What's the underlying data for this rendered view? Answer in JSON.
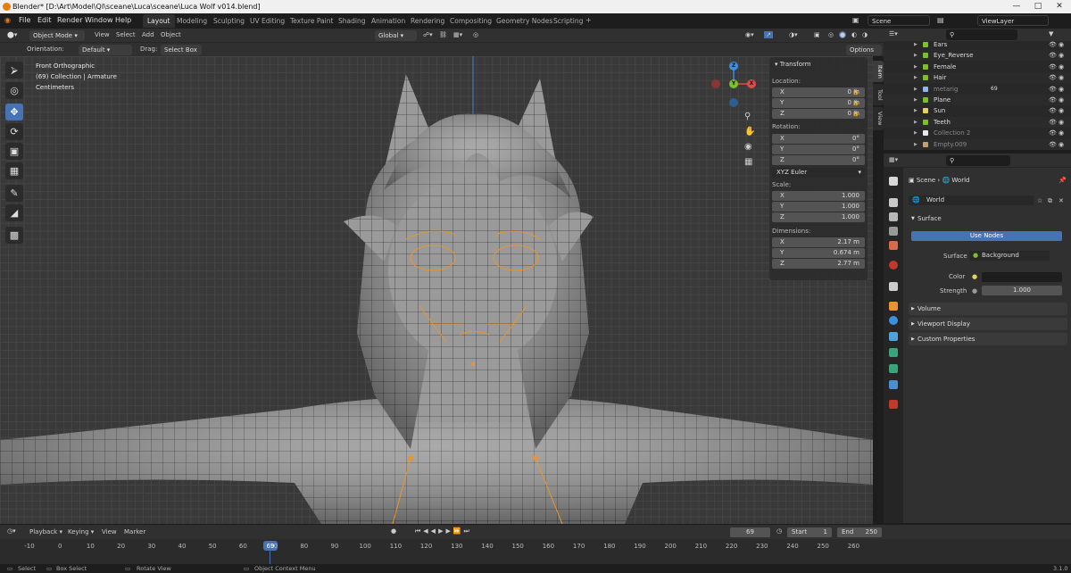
{
  "window": {
    "title": "Blender* [D:\\Art\\Model\\QI\\sceane\\Luca\\sceane\\Luca Wolf v014.blend]"
  },
  "menu": [
    "File",
    "Edit",
    "Render",
    "Window",
    "Help"
  ],
  "workspaces": [
    "Layout",
    "Modeling",
    "Sculpting",
    "UV Editing",
    "Texture Paint",
    "Shading",
    "Animation",
    "Rendering",
    "Compositing",
    "Geometry Nodes",
    "Scripting"
  ],
  "active_workspace": "Layout",
  "scene": "Scene",
  "view_layer": "ViewLayer",
  "viewport_header": {
    "mode": "Object Mode",
    "menus": [
      "View",
      "Select",
      "Add",
      "Object"
    ],
    "transform_orientation": "Global"
  },
  "tool_options": {
    "orientation_label": "Orientation:",
    "orientation_value": "Default",
    "drag_label": "Drag:",
    "drag_value": "Select Box",
    "options": "Options"
  },
  "viewport_info": {
    "view": "Front Orthographic",
    "collection": "(69) Collection | Armature",
    "units": "Centimeters"
  },
  "npanel": {
    "tabs": [
      "Item",
      "Tool",
      "View"
    ],
    "section": "Transform",
    "location_label": "Location:",
    "location": [
      {
        "axis": "X",
        "value": "0 m"
      },
      {
        "axis": "Y",
        "value": "0 m"
      },
      {
        "axis": "Z",
        "value": "0 m"
      }
    ],
    "rotation_label": "Rotation:",
    "rotation": [
      {
        "axis": "X",
        "value": "0°"
      },
      {
        "axis": "Y",
        "value": "0°"
      },
      {
        "axis": "Z",
        "value": "0°"
      }
    ],
    "rotation_mode": "XYZ Euler",
    "scale_label": "Scale:",
    "scale": [
      {
        "axis": "X",
        "value": "1.000"
      },
      {
        "axis": "Y",
        "value": "1.000"
      },
      {
        "axis": "Z",
        "value": "1.000"
      }
    ],
    "dimensions_label": "Dimensions:",
    "dimensions": [
      {
        "axis": "X",
        "value": "2.17 m"
      },
      {
        "axis": "Y",
        "value": "0.674 m"
      },
      {
        "axis": "Z",
        "value": "2.77 m"
      }
    ]
  },
  "outliner": {
    "items": [
      {
        "name": "Ears",
        "type": "mesh",
        "extra": ""
      },
      {
        "name": "Eye_Reverse",
        "type": "mesh",
        "extra": ""
      },
      {
        "name": "Female",
        "type": "mesh",
        "extra": ""
      },
      {
        "name": "Hair",
        "type": "mesh",
        "extra": ""
      },
      {
        "name": "metarig",
        "type": "armature",
        "extra": "69"
      },
      {
        "name": "Plane",
        "type": "mesh",
        "extra": ""
      },
      {
        "name": "Sun",
        "type": "light",
        "extra": ""
      },
      {
        "name": "Teeth",
        "type": "mesh",
        "extra": ""
      },
      {
        "name": "Collection 2",
        "type": "collection",
        "extra": ""
      },
      {
        "name": "Empty.009",
        "type": "empty",
        "extra": ""
      }
    ]
  },
  "properties": {
    "breadcrumb": [
      "Scene",
      "World"
    ],
    "world_name": "World",
    "surface_section": "Surface",
    "use_nodes": "Use Nodes",
    "surface_label": "Surface",
    "surface_value": "Background",
    "color_label": "Color",
    "strength_label": "Strength",
    "strength_value": "1.000",
    "collapsed_sections": [
      "Volume",
      "Viewport Display",
      "Custom Properties"
    ]
  },
  "timeline": {
    "menus": [
      "Playback",
      "Keying",
      "View",
      "Marker"
    ],
    "current_frame": "69",
    "start_label": "Start",
    "start": "1",
    "end_label": "End",
    "end": "250",
    "ticks": [
      "-10",
      "0",
      "10",
      "20",
      "30",
      "40",
      "50",
      "60",
      "70",
      "80",
      "90",
      "100",
      "110",
      "120",
      "130",
      "140",
      "150",
      "160",
      "170",
      "180",
      "190",
      "200",
      "210",
      "220",
      "230",
      "240",
      "250",
      "260"
    ]
  },
  "statusbar": {
    "items": [
      "Select",
      "Box Select",
      "Rotate View",
      "Object Context Menu"
    ],
    "version": "3.1.0"
  },
  "colors": {
    "accent": "#4772b3",
    "selection": "#e8952f",
    "x_axis": "#e04a4a",
    "y_axis": "#7bc02c",
    "z_axis": "#3c8fe0"
  }
}
